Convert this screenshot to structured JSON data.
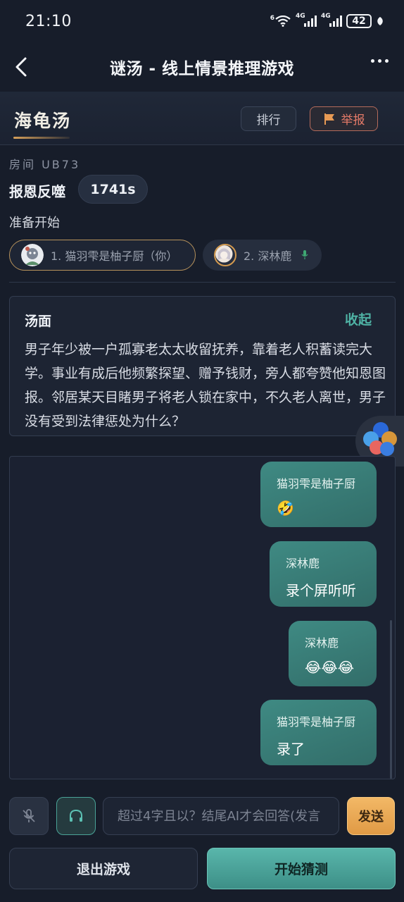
{
  "status_bar": {
    "time": "21:10",
    "network_1": "4G",
    "network_2": "4G",
    "wifi_badge": "6",
    "battery": "42"
  },
  "topbar": {
    "title": "谜汤 - 线上情景推理游戏"
  },
  "header": {
    "game_title": "海龟汤",
    "rank_label": "排行",
    "report_label": "举报"
  },
  "room": {
    "room_id": "房间 UB73",
    "puzzle_name": "报恩反噬",
    "timer": "1741s",
    "state": "准备开始"
  },
  "players": [
    {
      "label": "1. 猫羽雫是柚子厨（你）",
      "is_me": true
    },
    {
      "label": "2. 深林鹿",
      "is_me": false,
      "speaking": true
    }
  ],
  "puzzle": {
    "title": "汤面",
    "collapse_label": "收起",
    "text": "男子年少被一户孤寡老太太收留抚养，靠着老人积蓄读完大学。事业有成后他频繁探望、赠予钱财，旁人都夸赞他知恩图报。邻居某天目睹男子将老人锁在家中，不久老人离世，男子没有受到法律惩处为什么？"
  },
  "messages": [
    {
      "sender": "猫羽雫是柚子厨",
      "text": "🤣"
    },
    {
      "sender": "深林鹿",
      "text": "录个屏听听"
    },
    {
      "sender": "深林鹿",
      "text": "😂😂😂"
    },
    {
      "sender": "猫羽雫是柚子厨",
      "text": "录了"
    }
  ],
  "input": {
    "placeholder": "超过4字且以？结尾AI才会回答(发言",
    "value": "",
    "send_label": "发送"
  },
  "actions": {
    "exit_label": "退出游戏",
    "guess_label": "开始猜测"
  },
  "colors": {
    "background": "#171d2a",
    "accent_teal": "#4fb3a5",
    "bubble": "#3f8a83",
    "report_red": "#e47a68",
    "send_orange": "#e09a45",
    "title_gold": "#d6a05a"
  },
  "icons": {
    "back": "chevron-left-icon",
    "more": "more-dots-icon",
    "report": "flag-icon",
    "mute": "mic-off-icon",
    "audio": "headphones-icon",
    "speaking": "mic-icon",
    "floating": "floating-ball-icon"
  }
}
